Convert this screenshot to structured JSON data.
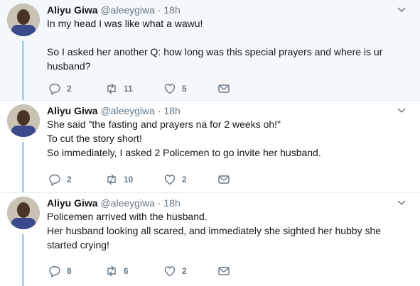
{
  "tweets": [
    {
      "name": "Aliyu Giwa",
      "handle": "@aleeygiwa",
      "time": "· 18h",
      "lines": [
        "In my head I was like what a wawu!",
        "",
        "So I asked her another Q: how long was this special prayers and where is ur",
        "husband?"
      ],
      "replies": "2",
      "retweets": "11",
      "likes": "5"
    },
    {
      "name": "Aliyu Giwa",
      "handle": "@aleeygiwa",
      "time": "· 18h",
      "lines": [
        "She said \"the fasting and prayers na for 2 weeks oh!\"",
        "To cut the story short!",
        "So immediately, I asked 2 Policemen to go invite her husband."
      ],
      "replies": "2",
      "retweets": "10",
      "likes": "2"
    },
    {
      "name": "Aliyu Giwa",
      "handle": "@aleeygiwa",
      "time": "· 18h",
      "lines": [
        "Policemen arrived with the husband.",
        "Her husband looking all scared, and immediately she sighted her hubby she",
        "started crying!"
      ],
      "replies": "8",
      "retweets": "6",
      "likes": "2"
    }
  ],
  "colors": {
    "thread_line": "#a3d3f5",
    "muted": "#657786",
    "highlight_bg": "#f5f8fa"
  },
  "icons": {
    "reply": "reply-icon",
    "retweet": "retweet-icon",
    "like": "heart-icon",
    "dm": "message-icon",
    "menu": "chevron-down-icon"
  }
}
